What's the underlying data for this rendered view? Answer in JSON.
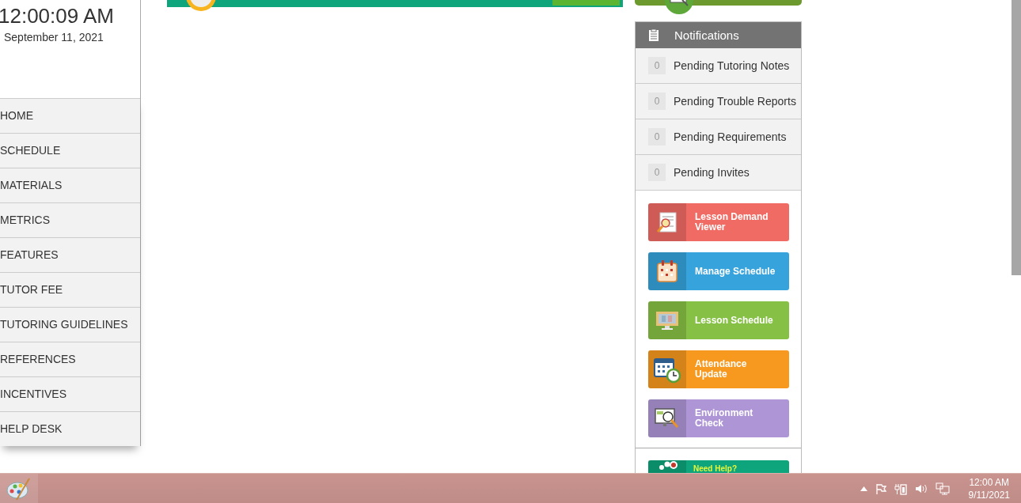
{
  "clock": {
    "time": "12:00:09 AM",
    "date": "September 11, 2021"
  },
  "menu": [
    {
      "label": "HOME"
    },
    {
      "label": "SCHEDULE"
    },
    {
      "label": "MATERIALS"
    },
    {
      "label": "METRICS"
    },
    {
      "label": "FEATURES"
    },
    {
      "label": "TUTOR FEE"
    },
    {
      "label": "TUTORING GUIDELINES"
    },
    {
      "label": "REFERENCES"
    },
    {
      "label": "INCENTIVES"
    },
    {
      "label": "HELP DESK"
    }
  ],
  "notifications": {
    "title": "Notifications",
    "items": [
      {
        "count": "0",
        "label": "Pending Tutoring Notes"
      },
      {
        "count": "0",
        "label": "Pending Trouble Reports"
      },
      {
        "count": "0",
        "label": "Pending Requirements"
      },
      {
        "count": "0",
        "label": "Pending Invites"
      }
    ]
  },
  "actions": [
    {
      "kind": "demand",
      "label": "Lesson Demand Viewer",
      "color": "#f06b63"
    },
    {
      "kind": "calendar",
      "label": "Manage Schedule",
      "color": "#36a3dd"
    },
    {
      "kind": "monitor",
      "label": "Lesson Schedule",
      "color": "#86c145"
    },
    {
      "kind": "attendance",
      "label": "Attendance Update",
      "color": "#f7981f"
    },
    {
      "kind": "check",
      "label": "Environment Check",
      "color": "#ae95d6"
    }
  ],
  "help": {
    "label": "Need Help?"
  },
  "taskbar": {
    "time": "12:00 AM",
    "date": "9/11/2021"
  }
}
